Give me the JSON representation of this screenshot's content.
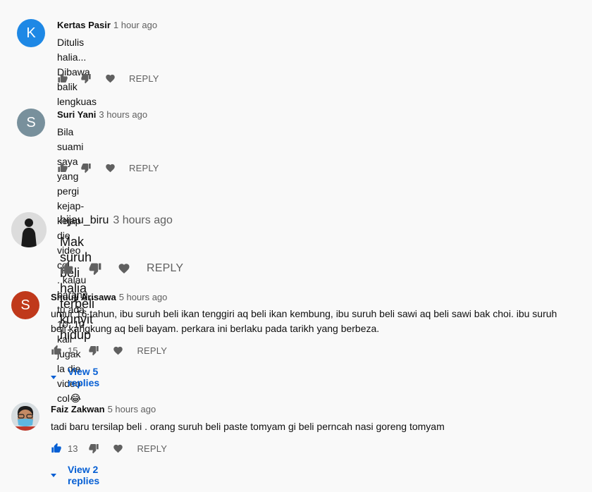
{
  "comments": [
    {
      "author": "Kertas Pasir",
      "time": "1 hour ago",
      "avatar_letter": "K",
      "avatar_color": "#1e88e5",
      "lines": [
        "Ditulis halia...",
        "Dibawa balik lengkuas"
      ],
      "likes": "",
      "reply_label": "REPLY"
    },
    {
      "author": "Suri Yani",
      "time": "3 hours ago",
      "avatar_letter": "S",
      "avatar_color": "#78909c",
      "lines": [
        "Bila suami saya yang pergi kejap-kejap die video col",
        ". kalau barang tu ada 10. 10 kali jugak la die video col😂"
      ],
      "likes": "",
      "reply_label": "REPLY"
    },
    {
      "author": "hijau_biru",
      "time": "3 hours ago",
      "avatar_icon": "silhouette-avatar",
      "lines": [
        "Mak suruh beli halia terbeli kunyit hidup"
      ],
      "likes": "",
      "reply_label": "REPLY"
    },
    {
      "author": "Shuuji Arisawa",
      "time": "5 hours ago",
      "avatar_letter": "S",
      "avatar_color": "#c0391b",
      "lines": [
        "umur 16 tahun, ibu suruh beli ikan tenggiri aq beli ikan kembung, ibu suruh beli sawi aq beli sawi bak choi. ibu suruh",
        "beli kangkung aq beli bayam. perkara ini berlaku pada tarikh yang berbeza."
      ],
      "likes": "15",
      "reply_label": "REPLY",
      "view_replies": "View 5 replies"
    },
    {
      "author": "Faiz Zakwan",
      "time": "5 hours ago",
      "avatar_icon": "masked-person-avatar",
      "lines": [
        "tadi baru tersilap beli . orang suruh beli paste tomyam gi beli perncah nasi goreng tomyam"
      ],
      "likes": "13",
      "liked": true,
      "reply_label": "REPLY",
      "view_replies": "View 2 replies"
    }
  ],
  "colors": {
    "background": "#f9f9f9",
    "text": "#0f0f0f",
    "secondary": "#606060",
    "link": "#065fd4"
  }
}
